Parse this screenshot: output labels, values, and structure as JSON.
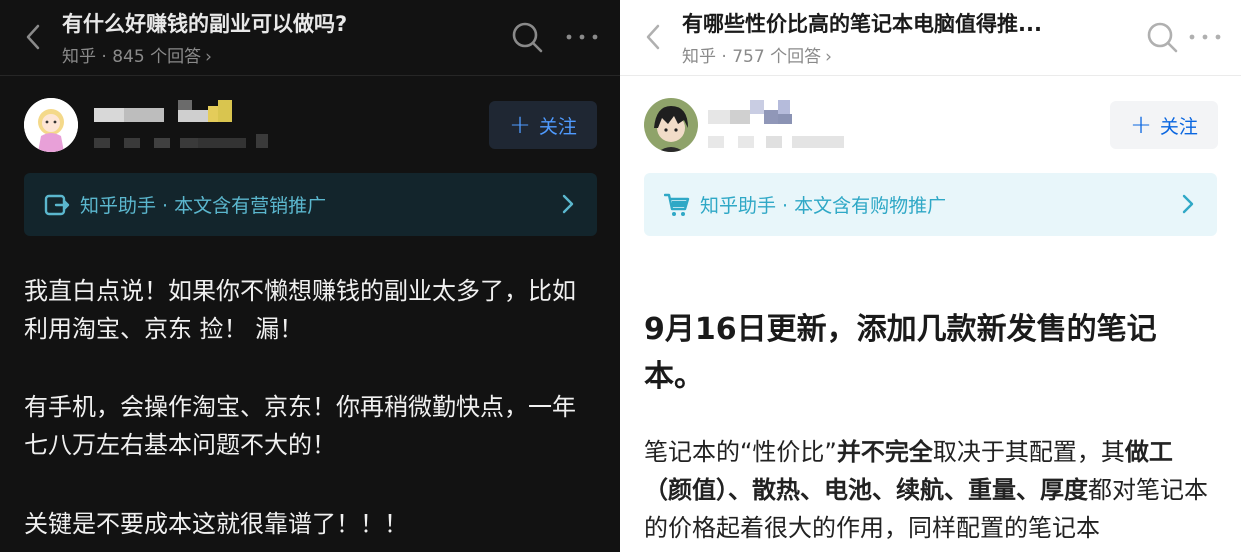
{
  "left": {
    "title": "有什么好赚钱的副业可以做吗?",
    "subtitle": "知乎 · 845 个回答",
    "follow_label": "关注",
    "helper_text": "知乎助手 · 本文含有营销推广",
    "paragraphs": [
      "我直白点说！如果你不懒想赚钱的副业太多了，比如利用淘宝、京东 捡！ 漏！",
      "有手机，会操作淘宝、京东！你再稍微勤快点，一年七八万左右基本问题不大的！",
      "关键是不要成本这就很靠谱了！！！"
    ]
  },
  "right": {
    "title": "有哪些性价比高的笔记本电脑值得推...",
    "subtitle": "知乎 · 757 个回答",
    "follow_label": "关注",
    "helper_text": "知乎助手 · 本文含有购物推广",
    "heading": "9月16日更新，添加几款新发售的笔记本。",
    "body_parts": [
      "笔记本的“性价比”",
      "并不完全",
      "取决于其配置，其",
      "做工（颜值）、散热、电池、续航、重量、厚度",
      "都对笔记本的价格起着很大的作用，同样配置的笔记本"
    ]
  },
  "colors": {
    "dark_bg": "#121212",
    "light_bg": "#ffffff",
    "dark_accent": "#4f9bff",
    "light_accent": "#0a66e0",
    "helper_teal": "#2fa8c6"
  },
  "icons": [
    "back-chevron-icon",
    "search-icon",
    "more-icon",
    "plus-icon",
    "marketing-icon",
    "cart-icon",
    "chevron-right-icon"
  ]
}
